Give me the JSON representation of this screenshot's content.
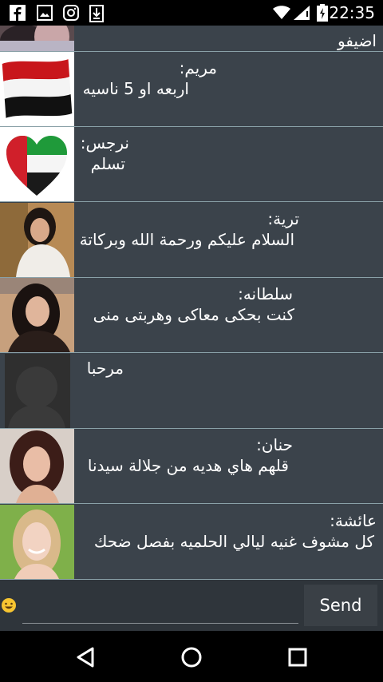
{
  "status_bar": {
    "time": "22:35",
    "icons": [
      "facebook-icon",
      "gallery-icon",
      "instagram-icon",
      "download-icon",
      "wifi-icon",
      "signal-icon",
      "battery-icon"
    ]
  },
  "colors": {
    "chat_bg": "#3b434b",
    "divider": "#8aa1a8",
    "input_bg": "#2f353b",
    "send_bg": "#3a4046"
  },
  "messages": [
    {
      "sender": "",
      "text": "اضيفو"
    },
    {
      "sender": "مريم:",
      "text": "اربعه او 5 ناسيه"
    },
    {
      "sender": "نرجس:",
      "text": "تسلم"
    },
    {
      "sender": "ترية:",
      "text": "السلام عليكم ورحمة الله وبركاتة"
    },
    {
      "sender": "سلطانه:",
      "text": "كنت بحكى معاكى وهربتى منى"
    },
    {
      "sender": "",
      "text": "مرحبا"
    },
    {
      "sender": "حنان:",
      "text": "قلهم هاي هديه من جلالة سيدنا"
    },
    {
      "sender": "عائشة:",
      "text": "كل مشوف غنيه ليالي الحلميه بفصل ضحك"
    }
  ],
  "input": {
    "placeholder": "",
    "value": "",
    "send_label": "Send"
  },
  "nav": [
    "back-icon",
    "home-icon",
    "recents-icon"
  ]
}
